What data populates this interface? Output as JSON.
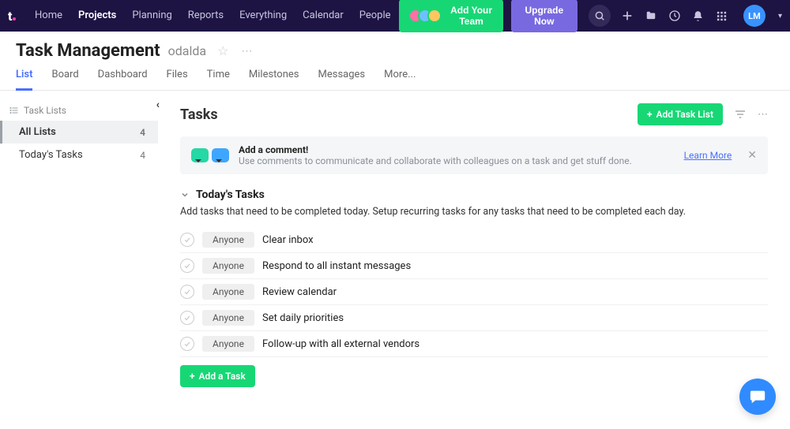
{
  "nav": {
    "links": [
      "Home",
      "Projects",
      "Planning",
      "Reports",
      "Everything",
      "Calendar",
      "People"
    ],
    "active": "Projects",
    "add_team": "Add Your Team",
    "upgrade": "Upgrade Now",
    "user_initials": "LM"
  },
  "header": {
    "title": "Task Management",
    "project": "odalda"
  },
  "tabs": {
    "items": [
      "List",
      "Board",
      "Dashboard",
      "Files",
      "Time",
      "Milestones",
      "Messages",
      "More..."
    ],
    "active": "List"
  },
  "sidebar": {
    "header": "Task Lists",
    "items": [
      {
        "label": "All Lists",
        "count": "4",
        "active": true
      },
      {
        "label": "Today's Tasks",
        "count": "4",
        "active": false
      }
    ]
  },
  "main": {
    "title": "Tasks",
    "add_list": "Add Task List",
    "banner": {
      "title": "Add a comment!",
      "sub": "Use comments to communicate and collaborate with colleagues on a task and get stuff done.",
      "learn": "Learn More"
    },
    "group": {
      "name": "Today's Tasks",
      "desc": "Add tasks that need to be completed today. Setup recurring tasks for any tasks that need to be completed each day."
    },
    "assignee_placeholder": "Anyone",
    "tasks": [
      {
        "title": "Clear inbox"
      },
      {
        "title": "Respond to all instant messages"
      },
      {
        "title": "Review calendar"
      },
      {
        "title": "Set daily priorities"
      },
      {
        "title": "Follow-up with all external vendors"
      }
    ],
    "add_task": "Add a Task"
  }
}
